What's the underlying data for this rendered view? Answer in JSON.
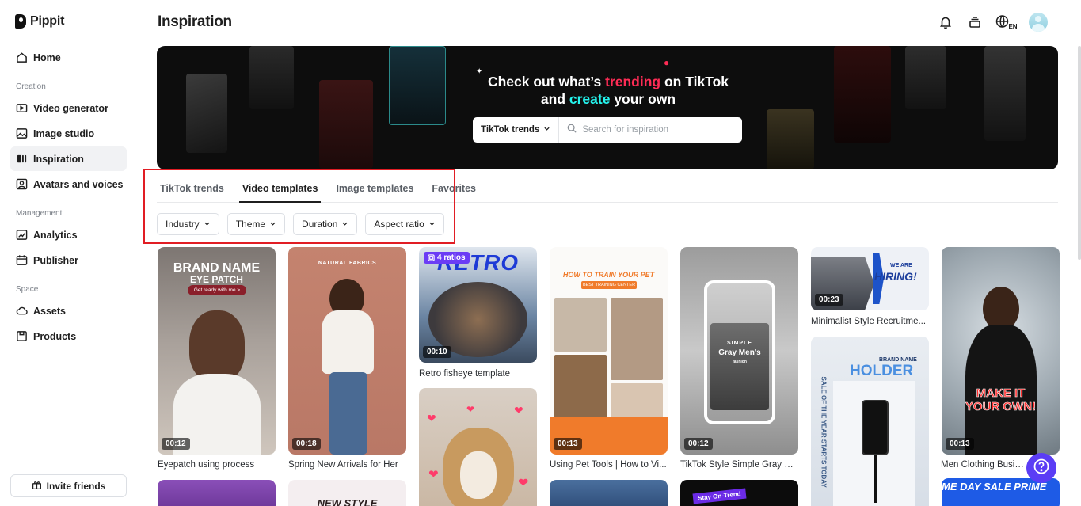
{
  "brand": {
    "name": "Pippit"
  },
  "sidebar": {
    "home": "Home",
    "sections": [
      {
        "label": "Creation",
        "items": [
          "Video generator",
          "Image studio",
          "Inspiration",
          "Avatars and voices"
        ]
      },
      {
        "label": "Management",
        "items": [
          "Analytics",
          "Publisher"
        ]
      },
      {
        "label": "Space",
        "items": [
          "Assets",
          "Products"
        ]
      }
    ],
    "active": "Inspiration",
    "invite": "Invite friends"
  },
  "header": {
    "title": "Inspiration",
    "language": "EN"
  },
  "banner": {
    "line1_pre": "Check out what’s ",
    "line1_highlight": "trending",
    "line1_post": " on TikTok",
    "line2_pre": "and ",
    "line2_highlight": "create",
    "line2_post": " your own",
    "search_select": "TikTok trends",
    "search_placeholder": "Search for inspiration"
  },
  "tabs": [
    "TikTok trends",
    "Video templates",
    "Image templates",
    "Favorites"
  ],
  "active_tab": "Video templates",
  "filters": [
    "Industry",
    "Theme",
    "Duration",
    "Aspect ratio"
  ],
  "cards": [
    {
      "title": "Eyepatch using process",
      "duration": "00:12",
      "overlay_title": "BRAND NAME",
      "overlay_sub": "EYE PATCH",
      "overlay_pill": "Get ready with me >"
    },
    {
      "title": "Spring New Arrivals for Her",
      "duration": "00:18",
      "overlay_title": "NATURAL FABRICS"
    },
    {
      "title": "Retro fisheye template",
      "duration": "00:10",
      "badge": "4 ratios",
      "overlay_title": "RETRO"
    },
    {
      "title": "Using Pet Tools | How to Vi...",
      "duration": "00:13",
      "overlay_title": "HOW TO TRAIN YOUR PET",
      "overlay_sub": "BEST TRAINING CENTER"
    },
    {
      "title": "TikTok Style Simple Gray M...",
      "duration": "00:12",
      "overlay_title": "SIMPLE",
      "overlay_sub": "Gray Men's",
      "overlay_small": "fashion"
    },
    {
      "title": "Minimalist Style Recruitme...",
      "duration": "00:23",
      "overlay_title": "HIRING!",
      "overlay_sub": "WE ARE"
    },
    {
      "title": "Men Clothing Busines...",
      "duration": "00:13",
      "overlay_title": "MAKE IT",
      "overlay_sub": "YOUR OWN!"
    }
  ],
  "partial_cards": {
    "holder_title": "HOLDER",
    "holder_small": "BRAND NAME",
    "holder_vertical": "SALE OF THE YEAR STARTS TODAY",
    "stay_on_trend": "Stay On-Trend",
    "new_style": "NEW STYLE",
    "sale_prime": "ME DAY SALE PRIME"
  },
  "colors": {
    "accent": "#5b3df5",
    "highlight_box": "#e11d24",
    "tiktok_pink": "#fe2c55",
    "tiktok_cyan": "#25f4ee"
  }
}
